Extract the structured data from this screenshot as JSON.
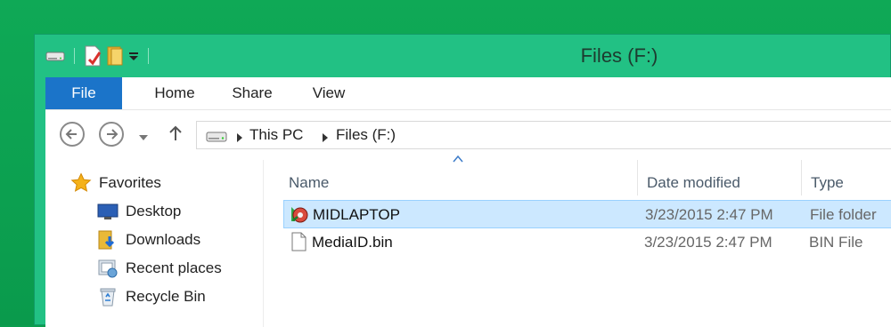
{
  "window": {
    "title": "Files (F:)"
  },
  "ribbon": {
    "tabs": [
      {
        "label": "File"
      },
      {
        "label": "Home"
      },
      {
        "label": "Share"
      },
      {
        "label": "View"
      }
    ]
  },
  "address": {
    "crumbs": [
      "This PC",
      "Files (F:)"
    ]
  },
  "navpane": {
    "items": [
      {
        "label": "Favorites",
        "icon": "star-icon"
      },
      {
        "label": "Desktop",
        "icon": "desktop-icon"
      },
      {
        "label": "Downloads",
        "icon": "downloads-icon"
      },
      {
        "label": "Recent places",
        "icon": "recent-places-icon"
      },
      {
        "label": "Recycle Bin",
        "icon": "recycle-bin-icon"
      }
    ]
  },
  "filelist": {
    "columns": [
      "Name",
      "Date modified",
      "Type"
    ],
    "rows": [
      {
        "name": "MIDLAPTOP",
        "date": "3/23/2015 2:47 PM",
        "type": "File folder",
        "icon": "special-folder-icon",
        "selected": true
      },
      {
        "name": "MediaID.bin",
        "date": "3/23/2015 2:47 PM",
        "type": "BIN File",
        "icon": "file-icon",
        "selected": false
      }
    ]
  },
  "colors": {
    "titlebar": "#22c184",
    "file_tab": "#1b74c9",
    "selection": "#cce8ff",
    "desktop": "#0b9d4e"
  }
}
